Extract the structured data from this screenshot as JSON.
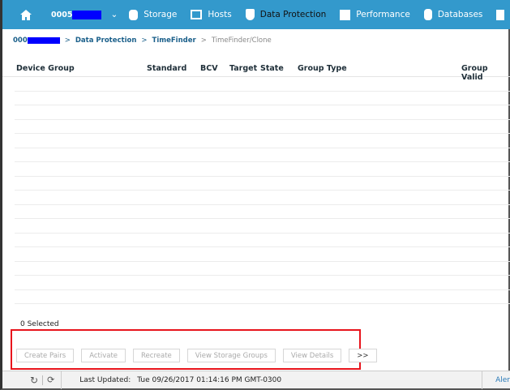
{
  "nav": {
    "system_prefix": "0005",
    "items": [
      {
        "label": "Storage",
        "icon": "database-icon"
      },
      {
        "label": "Hosts",
        "icon": "monitor-icon"
      },
      {
        "label": "Data Protection",
        "icon": "shield-icon",
        "active": true
      },
      {
        "label": "Performance",
        "icon": "bar-chart-icon"
      },
      {
        "label": "Databases",
        "icon": "cylinder-icon"
      }
    ]
  },
  "breadcrumb": {
    "system_prefix": "000",
    "items": [
      "Data Protection",
      "TimeFinder"
    ],
    "current": "TimeFinder/Clone",
    "separator": ">"
  },
  "table": {
    "columns": [
      "Device Group",
      "Standard",
      "BCV",
      "Target",
      "State",
      "Group Type",
      "Group Valid"
    ],
    "rows": []
  },
  "selection": "0 Selected",
  "actions": [
    "Create Pairs",
    "Activate",
    "Recreate",
    "View Storage Groups",
    "View Details",
    ">>"
  ],
  "footer": {
    "last_updated_label": "Last Updated:",
    "last_updated_value": "Tue 09/26/2017 01:14:16 PM GMT-0300",
    "alerts": "Aler"
  }
}
